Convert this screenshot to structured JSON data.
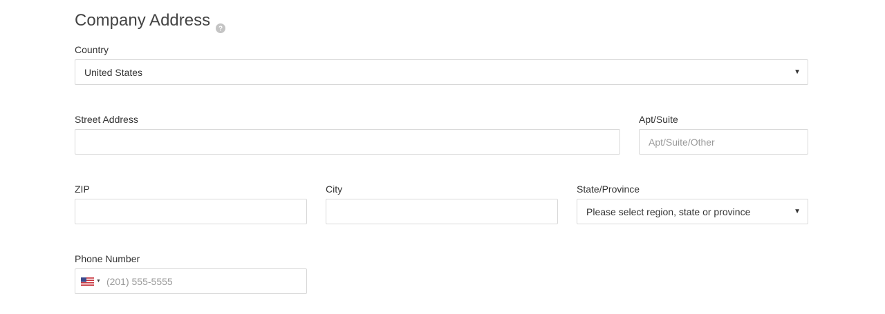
{
  "section": {
    "title": "Company Address",
    "help_icon": "question-circle-icon"
  },
  "country": {
    "label": "Country",
    "selected": "United States"
  },
  "street": {
    "label": "Street Address",
    "value": ""
  },
  "apt": {
    "label": "Apt/Suite",
    "placeholder": "Apt/Suite/Other"
  },
  "zip": {
    "label": "ZIP",
    "value": ""
  },
  "city": {
    "label": "City",
    "value": ""
  },
  "state": {
    "label": "State/Province",
    "selected": "Please select region, state or province"
  },
  "phone": {
    "label": "Phone Number",
    "placeholder": "(201) 555-5555",
    "country_flag": "us-flag-icon"
  },
  "colors": {
    "border": "#d8d8d8",
    "placeholder": "#9a9a9a",
    "text": "#333333"
  }
}
